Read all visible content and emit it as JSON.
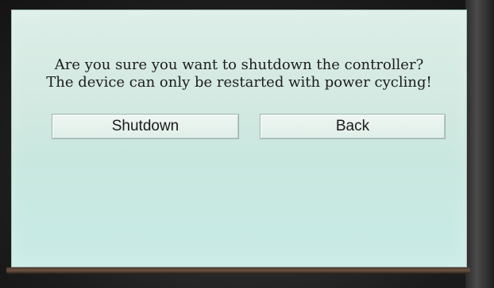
{
  "dialog": {
    "line1": "Are you sure you want to shutdown the controller?",
    "line2": "The device can only be restarted with power cycling!"
  },
  "buttons": {
    "shutdown_label": "Shutdown",
    "back_label": "Back"
  },
  "colors": {
    "screen_bg": "#d3e9e1",
    "text": "#1c1c1c",
    "button_bg": "#e6f2ed"
  }
}
